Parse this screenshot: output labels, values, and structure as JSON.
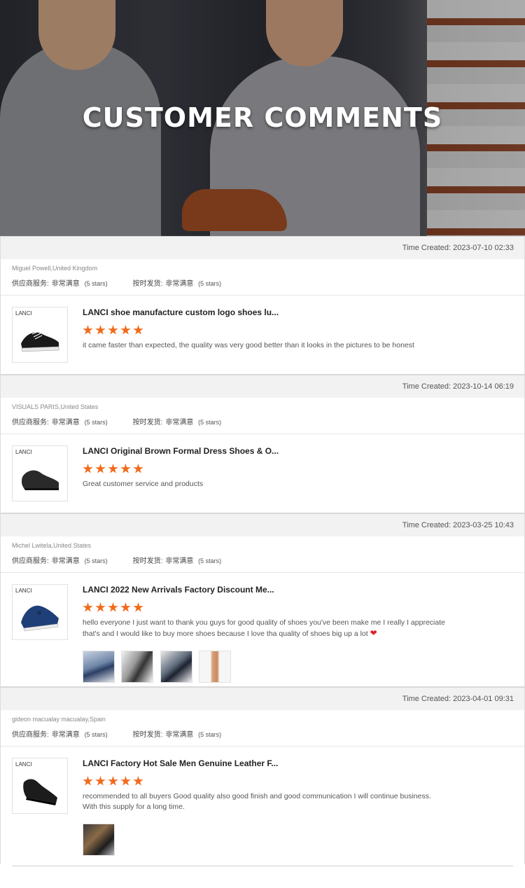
{
  "hero": {
    "title": "CUSTOMER COMMENTS"
  },
  "reviews": [
    {
      "time": "Time Created: 2023-07-10 02:33",
      "author": "Miguel Powell,United Kingdom",
      "service_label": "供应商服务:",
      "service_value": "非常满意",
      "service_stars": "(5 stars)",
      "delivery_label": "按时发货:",
      "delivery_value": "非常满意",
      "delivery_stars": "(5 stars)",
      "product_title": "LANCI shoe manufacture custom logo shoes lu...",
      "product_logo": "LANCI",
      "rating": 5,
      "comment": "it came faster than expected, the quality was very good better than it looks in the pictures to be honest",
      "photos": []
    },
    {
      "time": "Time Created: 2023-10-14 06:19",
      "author": "VISUALS PARIS,United States",
      "service_label": "供应商服务:",
      "service_value": "非常满意",
      "service_stars": "(5 stars)",
      "delivery_label": "按时发货:",
      "delivery_value": "非常满意",
      "delivery_stars": "(5 stars)",
      "product_title": "LANCI Original Brown Formal Dress Shoes & O...",
      "product_logo": "LANCI",
      "rating": 5,
      "comment": "Great customer service and products",
      "photos": []
    },
    {
      "time": "Time Created: 2023-03-25 10:43",
      "author": "Michel Lwitela,United States",
      "service_label": "供应商服务:",
      "service_value": "非常满意",
      "service_stars": "(5 stars)",
      "delivery_label": "按时发货:",
      "delivery_value": "非常满意",
      "delivery_stars": "(5 stars)",
      "product_title": "LANCI 2022 New Arrivals Factory Discount Me...",
      "product_logo": "LANCI",
      "rating": 5,
      "comment": "hello everyone  I just want to thank you guys  for good  quality of shoes  you've been make  me I really  I appreciate that's  and I would like to buy more shoes  because  I love  tha quality of shoes  big up  a lot",
      "comment_emoji": "❤",
      "photos": [
        "photo-1",
        "photo-2",
        "photo-3",
        "photo-4"
      ]
    },
    {
      "time": "Time Created: 2023-04-01 09:31",
      "author": "gideon macualay macualay,Spain",
      "service_label": "供应商服务:",
      "service_value": "非常满意",
      "service_stars": "(5 stars)",
      "delivery_label": "按时发货:",
      "delivery_value": "非常满意",
      "delivery_stars": "(5 stars)",
      "product_title": "LANCI Factory Hot Sale Men Genuine Leather F...",
      "product_logo": "LANCI",
      "rating": 5,
      "comment": "recommended to all buyers Good quality also good finish and good communication I will continue business. With this supply for a long time.",
      "photos": [
        "photo-1"
      ]
    }
  ],
  "colors": {
    "star": "#f26a1b",
    "header_bg": "#f2f2f2",
    "heart": "#e0202b"
  }
}
